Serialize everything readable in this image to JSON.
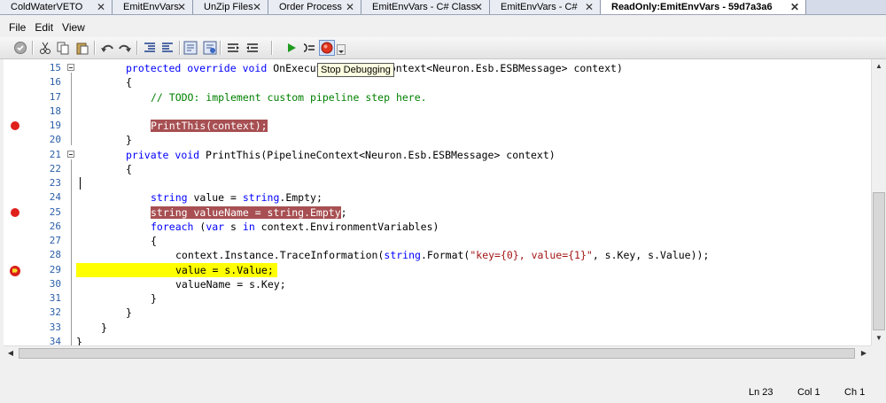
{
  "tabs": [
    {
      "label": "ColdWaterVETO"
    },
    {
      "label": "EmitEnvVars"
    },
    {
      "label": "UnZip Files"
    },
    {
      "label": "Order Process"
    },
    {
      "label": "EmitEnvVars - C# Class"
    },
    {
      "label": "EmitEnvVars - C#"
    },
    {
      "label": "ReadOnly:EmitEnvVars - 59d7a3a6"
    }
  ],
  "menu": {
    "file": "File",
    "edit": "Edit",
    "view": "View"
  },
  "toolbar": {
    "icons": [
      "check-icon",
      "cut-icon",
      "copy-icon",
      "paste-icon",
      "undo-icon",
      "redo-icon",
      "indent-icon",
      "outdent-icon",
      "comment-icon",
      "uncomment-icon",
      "align-left-icon",
      "align-right-icon",
      "play-icon",
      "step-icon",
      "stop-icon",
      "dropdown-icon"
    ],
    "tooltip": "Stop Debugging"
  },
  "editor": {
    "lines": [
      {
        "n": "15",
        "bp": "none",
        "hl": "none"
      },
      {
        "n": "16",
        "bp": "none",
        "hl": "none"
      },
      {
        "n": "17",
        "bp": "none",
        "hl": "none"
      },
      {
        "n": "18",
        "bp": "none",
        "hl": "none"
      },
      {
        "n": "19",
        "bp": "breakpoint",
        "hl": "breakpoint"
      },
      {
        "n": "20",
        "bp": "none",
        "hl": "none"
      },
      {
        "n": "21",
        "bp": "none",
        "hl": "none"
      },
      {
        "n": "22",
        "bp": "none",
        "hl": "none"
      },
      {
        "n": "23",
        "bp": "none",
        "hl": "none"
      },
      {
        "n": "24",
        "bp": "none",
        "hl": "none"
      },
      {
        "n": "25",
        "bp": "breakpoint",
        "hl": "breakpoint"
      },
      {
        "n": "26",
        "bp": "none",
        "hl": "none"
      },
      {
        "n": "27",
        "bp": "none",
        "hl": "none"
      },
      {
        "n": "28",
        "bp": "none",
        "hl": "none"
      },
      {
        "n": "29",
        "bp": "current",
        "hl": "current"
      },
      {
        "n": "30",
        "bp": "none",
        "hl": "none"
      },
      {
        "n": "31",
        "bp": "none",
        "hl": "none"
      },
      {
        "n": "32",
        "bp": "none",
        "hl": "none"
      },
      {
        "n": "33",
        "bp": "none",
        "hl": "none"
      },
      {
        "n": "34",
        "bp": "none",
        "hl": "none"
      }
    ],
    "code": {
      "l15_kw1": "protected",
      "l15_kw2": "override",
      "l15_kw3": "void",
      "l15_rest": "OnExecute(PipelineContext<Neuron.Esb.ESBMessage> context)",
      "l16": "{",
      "l17": "// TODO: implement custom pipeline step here.",
      "l19": "PrintThis(context);",
      "l20": "}",
      "l21_kw1": "private",
      "l21_kw2": "void",
      "l21_rest": "PrintThis(PipelineContext<Neuron.Esb.ESBMessage> context)",
      "l22": "{",
      "l24_kw1": "string",
      "l24_mid": " value = ",
      "l24_kw2": "string",
      "l24_rest": ".Empty;",
      "l25": "string valueName = string.Empty",
      "l25_tail": ";",
      "l26_kw1": "foreach",
      "l26_mid": " (",
      "l26_kw2": "var",
      "l26_mid2": " s ",
      "l26_kw3": "in",
      "l26_rest": " context.EnvironmentVariables)",
      "l27": "{",
      "l28_a": "context.Instance.TraceInformation(",
      "l28_kw": "string",
      "l28_b": ".Format(",
      "l28_str": "\"key={0}, value={1}\"",
      "l28_c": ", s.Key, s.Value));",
      "l29": "value = s.Value;",
      "l30": "valueName = s.Key;",
      "l31": "}",
      "l32": "}",
      "l33": "}",
      "l34": "}"
    }
  },
  "status": {
    "ln": "Ln 23",
    "col": "Col 1",
    "ch": "Ch 1"
  }
}
